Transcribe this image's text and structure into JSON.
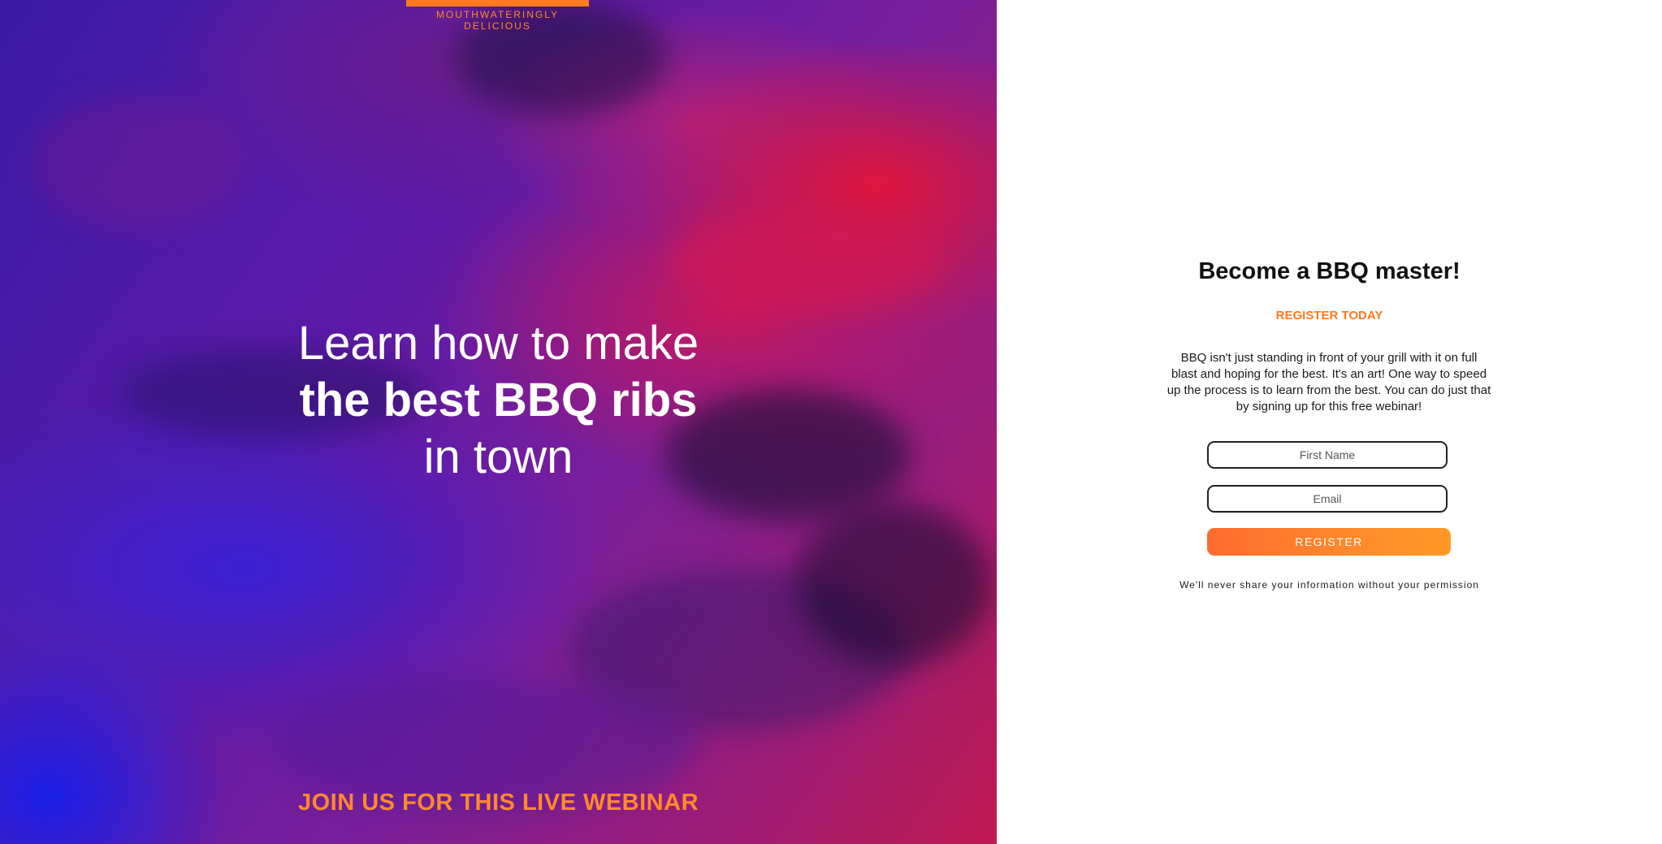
{
  "hero": {
    "tagline": "MOUTHWATERINGLY DELICIOUS",
    "headline_line1": "Learn how to make",
    "headline_line2": "the best BBQ ribs",
    "headline_line3": "in town",
    "webinar_text": "JOIN US FOR THIS LIVE WEBINAR",
    "accent_color": "#ff7a1f"
  },
  "form": {
    "title": "Become a BBQ master!",
    "subtitle": "REGISTER TODAY",
    "description": "BBQ isn't just standing in front of your grill with it on full blast and hoping for the best. It's an art! One way to speed up the process is to learn from the best. You can do just that by signing up for this free webinar!",
    "first_name_placeholder": "First Name",
    "email_placeholder": "Email",
    "register_label": "REGISTER",
    "privacy_note": "We'll never share your information without your permission"
  }
}
